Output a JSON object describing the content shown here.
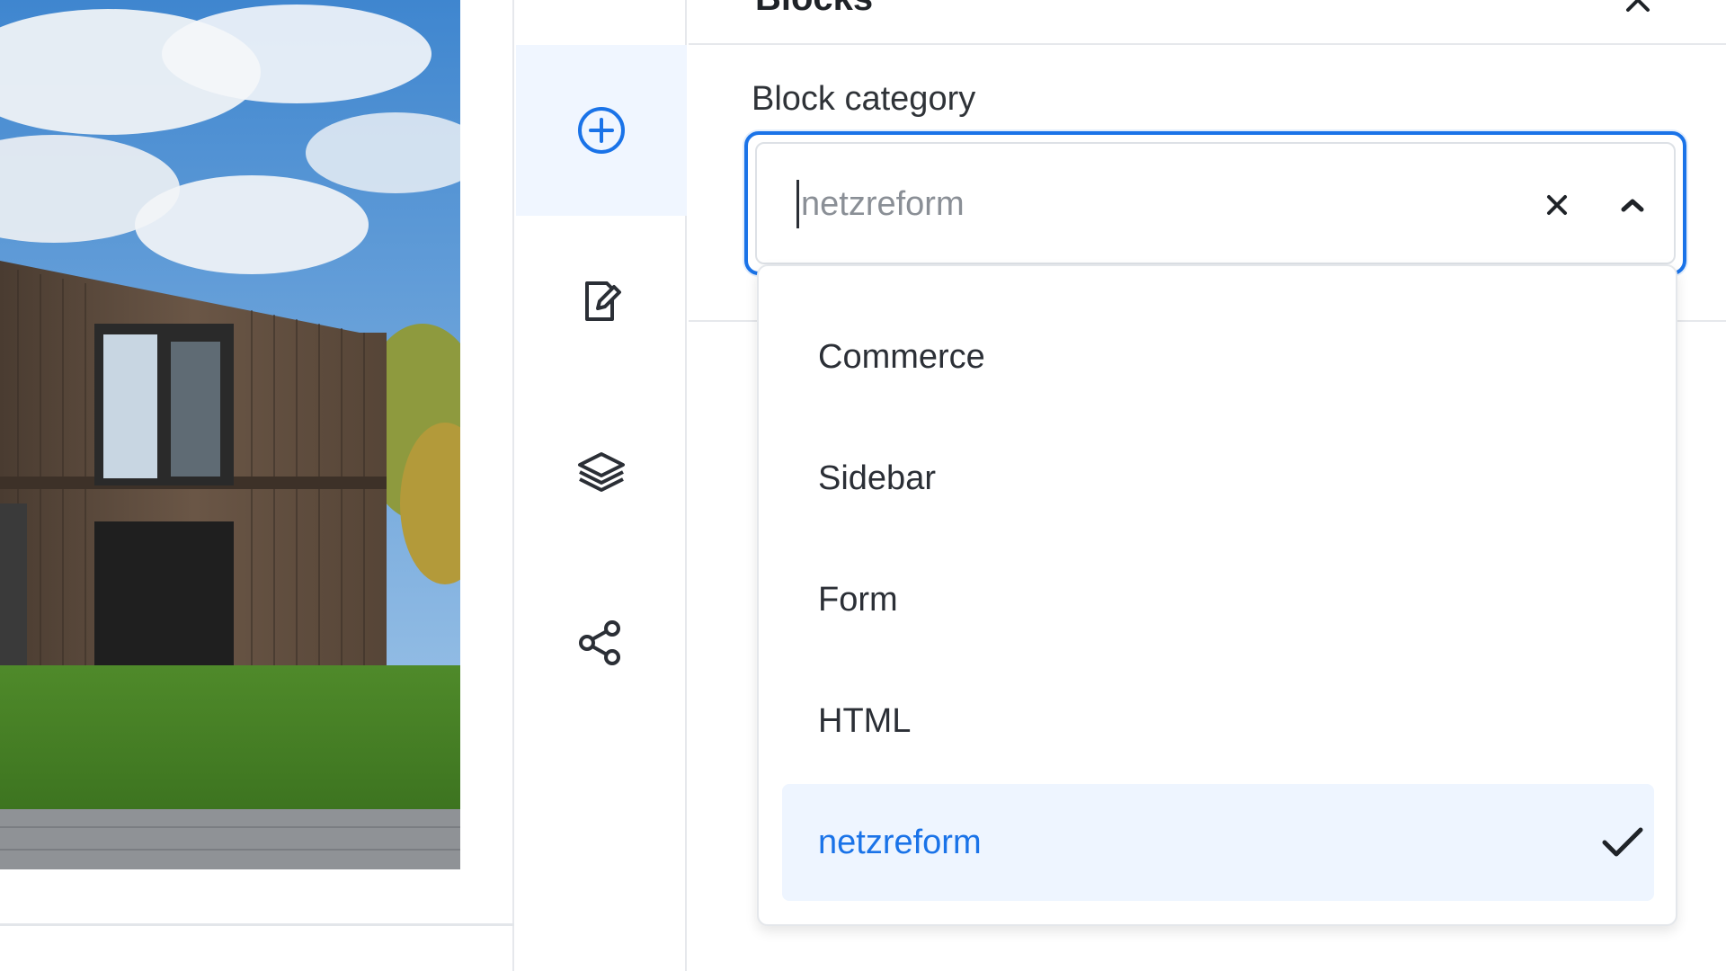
{
  "panel": {
    "title": "Blocks"
  },
  "block_category": {
    "label": "Block category",
    "input_value": "",
    "placeholder": "netzreform",
    "options": [
      {
        "label": "Commerce",
        "selected": false
      },
      {
        "label": "Sidebar",
        "selected": false
      },
      {
        "label": "Form",
        "selected": false
      },
      {
        "label": "HTML",
        "selected": false
      },
      {
        "label": "netzreform",
        "selected": true
      }
    ]
  },
  "rail": {
    "items": [
      {
        "icon": "plus-circle-icon",
        "active": true
      },
      {
        "icon": "edit-page-icon",
        "active": false
      },
      {
        "icon": "layers-icon",
        "active": false
      },
      {
        "icon": "share-icon",
        "active": false
      }
    ]
  },
  "colors": {
    "accent": "#1a73e8",
    "selected_bg": "#eef5ff",
    "active_rail_bg": "#f0f6ff"
  }
}
